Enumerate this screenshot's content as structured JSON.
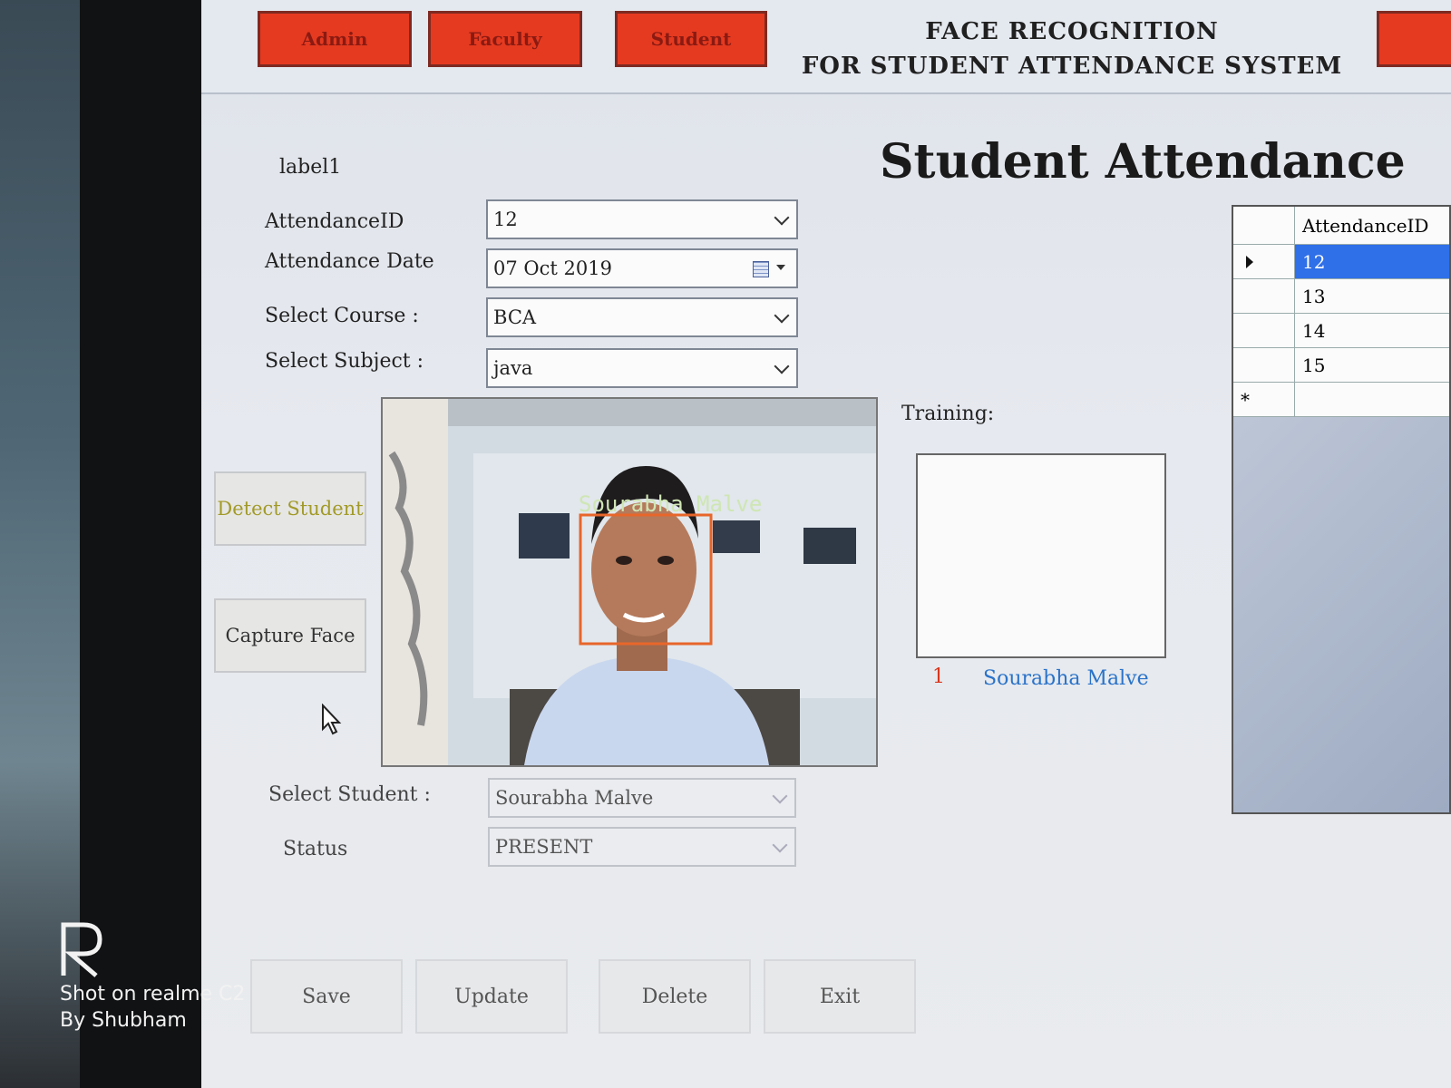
{
  "nav": {
    "admin": "Admin",
    "faculty": "Faculty",
    "student": "Student",
    "app_title_line1": "FACE RECOGNITION",
    "app_title_line2": "FOR STUDENT ATTENDANCE SYSTEM"
  },
  "form": {
    "label1": "label1",
    "page_heading": "Student Attendance",
    "attendance_id_label": "AttendanceID",
    "attendance_id_value": "12",
    "attendance_date_label": "Attendance Date",
    "attendance_date_value": "07 Oct 2019",
    "course_label": "Select Course :",
    "course_value": "BCA",
    "subject_label": "Select Subject :",
    "subject_value": "java",
    "student_label": "Select Student :",
    "student_value": "Sourabha Malve",
    "status_label": "Status",
    "status_value": "PRESENT"
  },
  "camera": {
    "detected_name": "Sourabha Malve"
  },
  "side_buttons": {
    "detect": "Detect Student",
    "capture": "Capture Face"
  },
  "training": {
    "label": "Training:",
    "count": "1",
    "name": "Sourabha Malve"
  },
  "grid": {
    "header": "AttendanceID",
    "rows": [
      "12",
      "13",
      "14",
      "15"
    ],
    "new_row_marker": "*"
  },
  "actions": {
    "save": "Save",
    "update": "Update",
    "delete": "Delete",
    "exit": "Exit"
  },
  "watermark": {
    "line1": "Shot on realme C2",
    "line2": "By Shubham"
  },
  "colors": {
    "nav_button": "#e53a20",
    "detect_text": "#a29a28",
    "training_count": "#d9361c",
    "training_name": "#2a73c9",
    "grid_selected": "#2f6fe8",
    "face_box": "#e8662a"
  }
}
